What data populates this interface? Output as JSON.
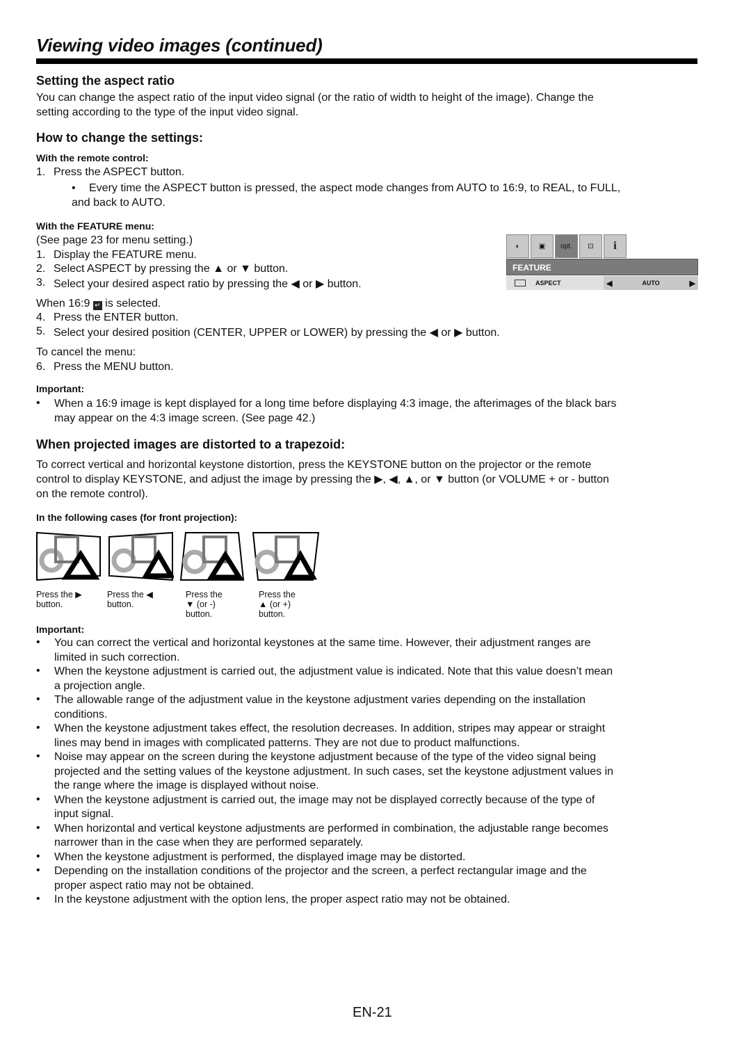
{
  "page": {
    "title": "Viewing video images (continued)",
    "page_number": "EN-21"
  },
  "aspect": {
    "heading": "Setting the aspect ratio",
    "intro_line1": "You can change the aspect ratio of the input video signal (or the ratio of width to height of the image). Change the",
    "intro_line2": "setting according to the type of the input video signal.",
    "how_heading": "How to change the settings:",
    "remote_heading": "With the remote control:",
    "remote_step1_num": "1.",
    "remote_step1": "Press the ASPECT button.",
    "remote_bullet_line1": "Every time the ASPECT button is pressed, the aspect mode changes from AUTO to 16:9, to REAL, to FULL,",
    "remote_bullet_line2": "and back to AUTO.",
    "feature_heading": "With the FEATURE menu:",
    "feature_note": "(See page 23 for menu setting.)",
    "steps": [
      {
        "num": "1.",
        "text": "Display the FEATURE menu."
      },
      {
        "num": "2.",
        "text": "Select ASPECT by pressing the ▲ or ▼ button."
      },
      {
        "num": "3.",
        "text": "Select your desired aspect ratio by pressing the ◀ or ▶ button."
      }
    ],
    "when169_pre": "When 16:9",
    "when169_post": "is selected.",
    "enter_icon": "↵",
    "steps2": [
      {
        "num": "4.",
        "text": "Press the ENTER button."
      },
      {
        "num": "5.",
        "text": "Select your desired position (CENTER, UPPER or LOWER) by pressing the ◀ or ▶ button."
      }
    ],
    "cancel_label": "To cancel the menu:",
    "step6": {
      "num": "6.",
      "text": "Press the MENU button."
    },
    "important_label": "Important:",
    "important_line1": "When a 16:9 image is kept displayed for a long time before displaying 4:3 image, the afterimages of the black bars",
    "important_line2": "may appear on the 4:3 image screen. (See page 42.)"
  },
  "osd": {
    "tabs": [
      {
        "name": "picture-icon",
        "glyph": "◐"
      },
      {
        "name": "image-icon",
        "glyph": "▣"
      },
      {
        "name": "option-icon",
        "glyph": "opt."
      },
      {
        "name": "installation-icon",
        "glyph": "⊡"
      },
      {
        "name": "info-icon",
        "glyph": "i"
      }
    ],
    "menu_title": "FEATURE",
    "row_label": "ASPECT",
    "row_value": "AUTO",
    "left_arrow": "◀",
    "right_arrow": "▶"
  },
  "keystone": {
    "heading": "When projected images are distorted to a trapezoid:",
    "text_line1": "To correct vertical and horizontal keystone distortion, press the KEYSTONE button on the projector or the remote",
    "text_line2": "control to display KEYSTONE, and adjust the image by pressing the ▶, ◀, ▲, or ▼ button (or VOLUME + or - button",
    "text_line3": "on the remote control).",
    "cases_heading": "In the following cases (for front projection):",
    "captions": [
      [
        "Press the ▶",
        "button."
      ],
      [
        "Press the ◀",
        "button."
      ],
      [
        "Press the",
        "▼ (or -)",
        "button."
      ],
      [
        "Press the",
        "▲ (or +)",
        "button."
      ]
    ],
    "important_label": "Important:",
    "bullets": [
      [
        "You can correct the vertical and horizontal keystones at the same time. However, their adjustment ranges are",
        "limited in such correction."
      ],
      [
        "When the keystone adjustment is carried out, the adjustment value is indicated. Note that this value doesn’t mean",
        "a projection angle."
      ],
      [
        "The allowable range of the adjustment value in the keystone adjustment varies depending on the installation",
        "conditions."
      ],
      [
        "When the keystone adjustment takes effect, the resolution decreases. In addition, stripes may appear or straight",
        "lines may bend in images with complicated patterns. They are not due to product malfunctions."
      ],
      [
        "Noise may appear on the screen during the keystone adjustment because of the type of the video signal being",
        "projected and the setting values of the keystone adjustment. In such cases, set the keystone adjustment values in",
        "the range where the image is displayed without noise."
      ],
      [
        "When the keystone adjustment is carried out, the image may not be displayed correctly because of the type of",
        "input signal."
      ],
      [
        "When horizontal and vertical keystone adjustments are performed in combination, the adjustable range becomes",
        "narrower than in the case when they are performed separately."
      ],
      [
        "When the keystone adjustment is performed, the displayed image may be distorted."
      ],
      [
        "Depending on the installation conditions of the projector and the screen, a perfect rectangular image and the",
        "proper aspect ratio may not be obtained."
      ],
      [
        "In the keystone adjustment with the option lens, the proper aspect ratio may not be obtained."
      ]
    ]
  }
}
